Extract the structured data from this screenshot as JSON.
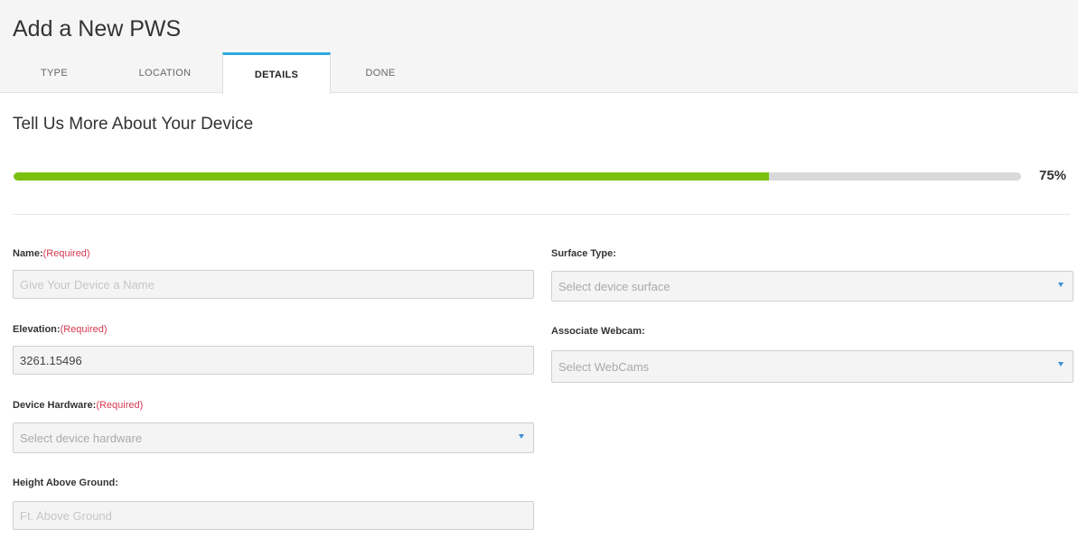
{
  "header": {
    "title": "Add a New PWS",
    "tabs": [
      {
        "label": "TYPE",
        "active": false
      },
      {
        "label": "LOCATION",
        "active": false
      },
      {
        "label": "DETAILS",
        "active": true
      },
      {
        "label": "DONE",
        "active": false
      }
    ]
  },
  "section": {
    "title": "Tell Us More About Your Device"
  },
  "progress": {
    "value": 0.75,
    "label": "75%",
    "color": "#7cc00f"
  },
  "form": {
    "required_text": "(Required)",
    "name": {
      "label": "Name:",
      "placeholder": "Give Your Device a Name",
      "value": ""
    },
    "elevation": {
      "label": "Elevation:",
      "value": "3261.15496"
    },
    "device_hardware": {
      "label": "Device Hardware:",
      "placeholder": "Select device hardware",
      "icon": "caret-down-icon"
    },
    "height_above_ground": {
      "label": "Height Above Ground:",
      "placeholder": "Ft. Above Ground"
    },
    "surface_type": {
      "label": "Surface Type:",
      "placeholder": "Select device surface",
      "icon": "caret-down-icon"
    },
    "associate_webcam": {
      "label": "Associate Webcam:",
      "placeholder": "Select WebCams",
      "icon": "caret-down-icon"
    }
  },
  "colors": {
    "accent_tab": "#2eaadc",
    "required": "#d4384f",
    "caret": "#3b8fd6"
  }
}
